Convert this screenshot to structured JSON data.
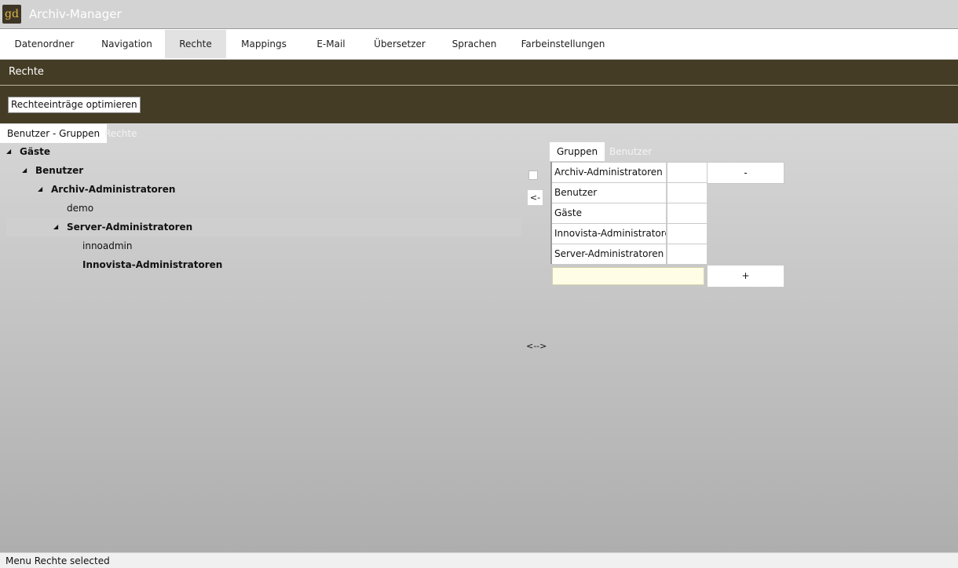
{
  "app": {
    "logo_text": "gd",
    "title": "Archiv-Manager"
  },
  "menu": {
    "items": [
      {
        "label": "Datenordner"
      },
      {
        "label": "Navigation"
      },
      {
        "label": "Rechte",
        "active": true
      },
      {
        "label": "Mappings"
      },
      {
        "label": "E-Mail"
      },
      {
        "label": "Übersetzer"
      },
      {
        "label": "Sprachen"
      },
      {
        "label": "Farbeinstellungen"
      }
    ]
  },
  "section": {
    "title": "Rechte",
    "optimize_button": "Rechteeinträge optimieren"
  },
  "left_tabs": [
    {
      "label": "Benutzer - Gruppen",
      "active": true
    },
    {
      "label": "Rechte",
      "active": false
    }
  ],
  "tree": [
    {
      "label": "Gäste",
      "bold": true,
      "expanded": true
    },
    {
      "label": "Benutzer",
      "bold": true,
      "expanded": true
    },
    {
      "label": "Archiv-Administratoren",
      "bold": true,
      "expanded": true
    },
    {
      "label": "demo",
      "bold": false
    },
    {
      "label": "Server-Administratoren",
      "bold": true,
      "expanded": true,
      "selected": true
    },
    {
      "label": "innoadmin",
      "bold": false
    },
    {
      "label": "Innovista-Administratoren",
      "bold": true
    }
  ],
  "middle": {
    "move_left": "<-",
    "swap": "<-->"
  },
  "right_tabs": [
    {
      "label": "Gruppen",
      "active": true
    },
    {
      "label": "Benutzer",
      "active": false
    }
  ],
  "groups": [
    {
      "name": "Archiv-Administratoren"
    },
    {
      "name": "Benutzer"
    },
    {
      "name": "Gäste"
    },
    {
      "name": "Innovista-Administratoren"
    },
    {
      "name": "Server-Administratoren"
    }
  ],
  "buttons": {
    "remove": "-",
    "add": "+"
  },
  "new_group_input": {
    "value": "",
    "placeholder": ""
  },
  "status": {
    "text": "Menu Rechte selected"
  },
  "colors": {
    "header_band": "#443c25",
    "input_bg": "#fffde6",
    "active_menu": "#e2e2e2"
  }
}
